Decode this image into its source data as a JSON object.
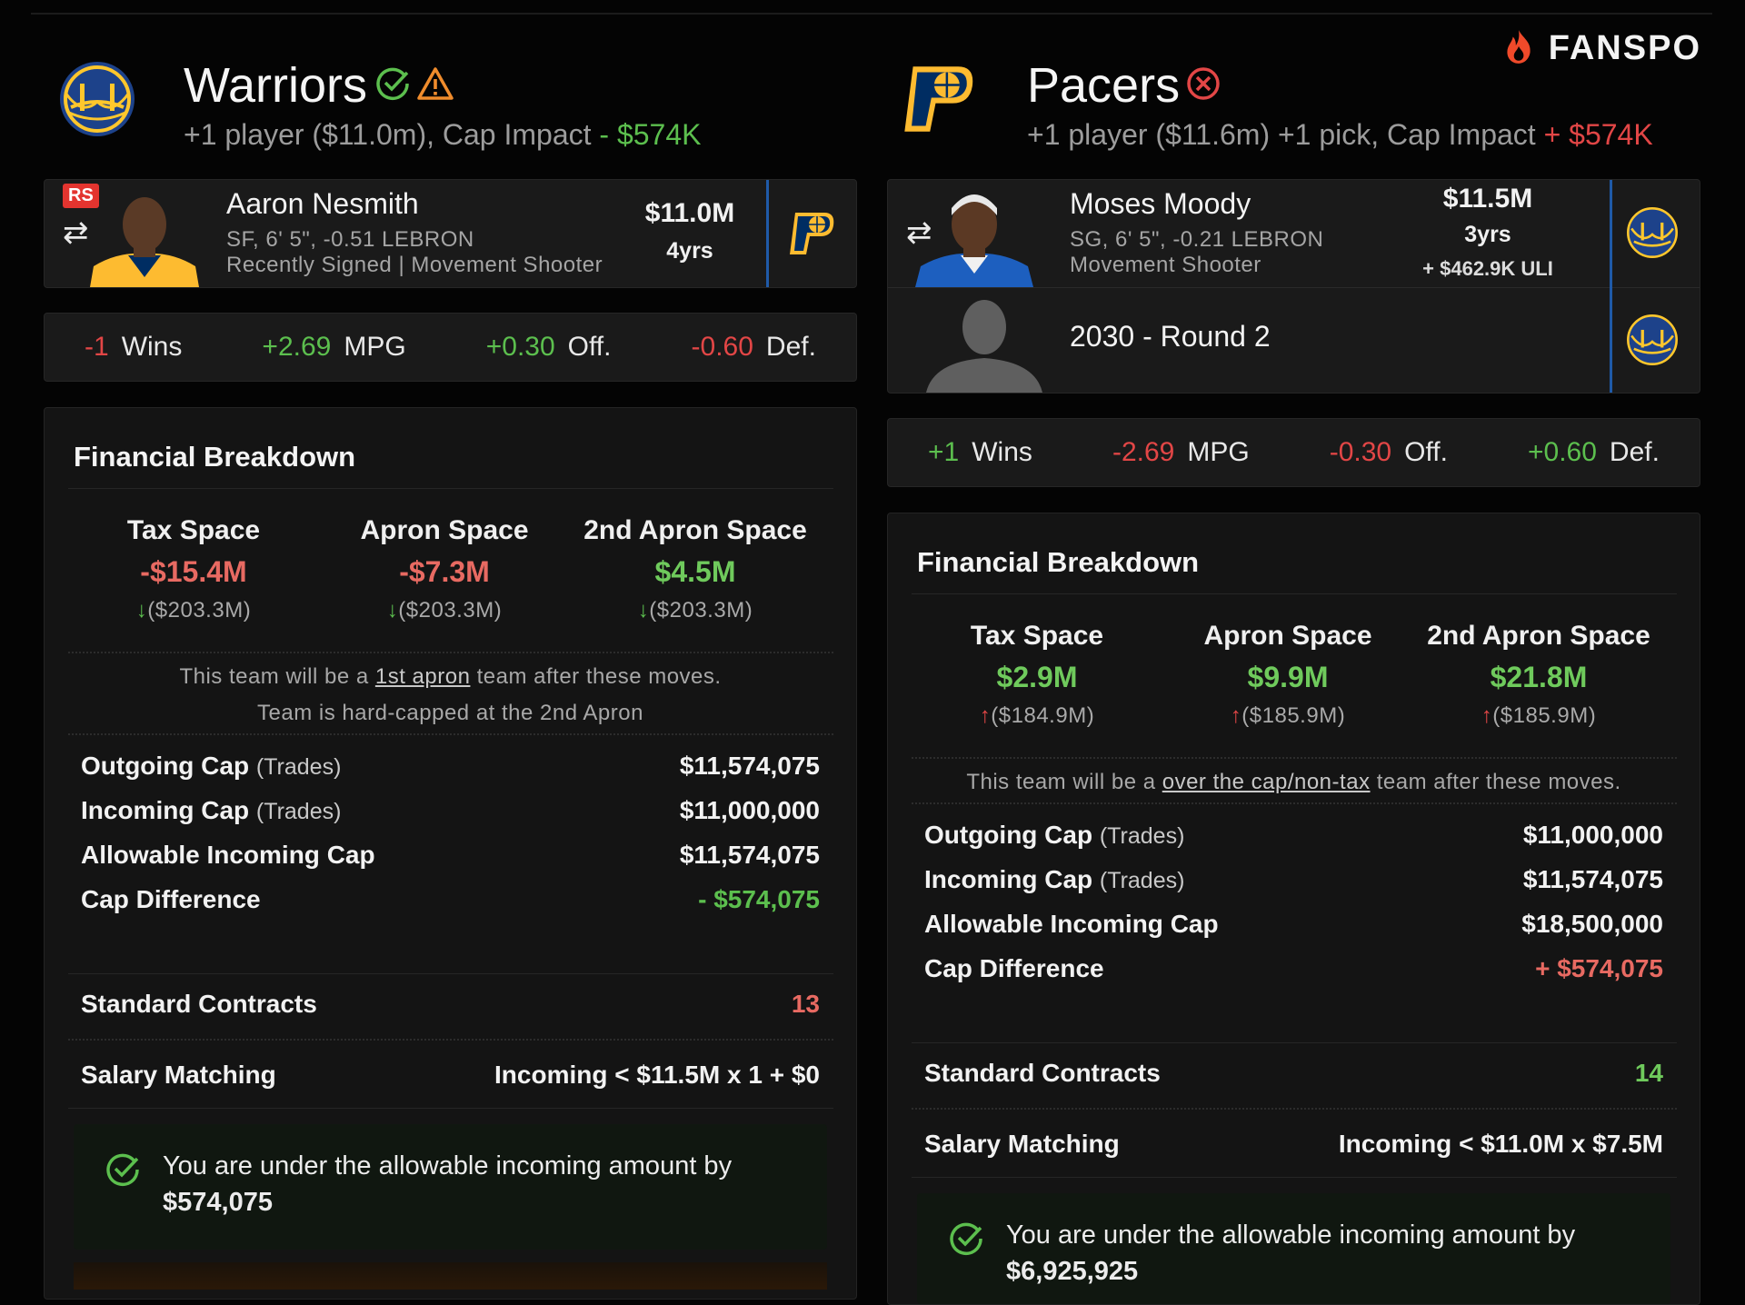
{
  "brand": {
    "name": "FANSPO",
    "icon": "flame-icon"
  },
  "left": {
    "team": {
      "name": "Warriors",
      "logo": "warriors-logo",
      "status_icons": [
        "check-circle-icon",
        "warning-triangle-icon"
      ]
    },
    "summary": {
      "text": "+1 player ($11.0m), Cap Impact",
      "sign": "-",
      "impact": "$574K",
      "impact_color": "#5cbf4e"
    },
    "player": {
      "badge": "RS",
      "name": "Aaron Nesmith",
      "meta1": "SF, 6' 5\", -0.51 LEBRON",
      "meta2": "Recently Signed | Movement Shooter",
      "salary": "$11.0M",
      "years": "4yrs",
      "from_team_logo": "pacers-logo"
    },
    "stats": [
      {
        "value": "-1",
        "label": "Wins",
        "color": "#e24646"
      },
      {
        "value": "+2.69",
        "label": "MPG",
        "color": "#5cbf4e"
      },
      {
        "value": "+0.30",
        "label": "Off.",
        "color": "#5cbf4e"
      },
      {
        "value": "-0.60",
        "label": "Def.",
        "color": "#e24646"
      }
    ],
    "financial": {
      "title": "Financial Breakdown",
      "spaces": [
        {
          "header": "Tax Space",
          "value": "-$15.4M",
          "value_color": "#e86a62",
          "delta": "($203.3M)",
          "arrow": "down",
          "arrow_color": "#5cbf4e"
        },
        {
          "header": "Apron Space",
          "value": "-$7.3M",
          "value_color": "#e86a62",
          "delta": "($203.3M)",
          "arrow": "down",
          "arrow_color": "#5cbf4e"
        },
        {
          "header": "2nd Apron Space",
          "value": "$4.5M",
          "value_color": "#6fca5c",
          "delta": "($203.3M)",
          "arrow": "down",
          "arrow_color": "#5cbf4e"
        }
      ],
      "note_pre": "This team will be a",
      "note_link": "1st apron",
      "note_post": "team after these moves.",
      "hardcap": "Team is hard-capped at the 2nd Apron",
      "rows": [
        {
          "label": "Outgoing Cap",
          "sub": "(Trades)",
          "value": "$11,574,075",
          "color": "#f2f2f2"
        },
        {
          "label": "Incoming Cap",
          "sub": "(Trades)",
          "value": "$11,000,000",
          "color": "#f2f2f2"
        },
        {
          "label": "Allowable Incoming Cap",
          "sub": "",
          "value": "$11,574,075",
          "color": "#f2f2f2"
        },
        {
          "label": "Cap Difference",
          "sub": "",
          "value": "- $574,075",
          "color": "#5cbf4e"
        }
      ],
      "contracts": {
        "label": "Standard Contracts",
        "value": "13",
        "color": "#e86a62"
      },
      "matching": {
        "label": "Salary Matching",
        "value": "Incoming < $11.5M x 1 + $0"
      },
      "callout": {
        "text": "You are under the allowable incoming amount by",
        "amount": "$574,075"
      }
    }
  },
  "right": {
    "team": {
      "name": "Pacers",
      "logo": "pacers-logo",
      "status_icons": [
        "x-circle-icon"
      ]
    },
    "summary": {
      "text": "+1 player ($11.6m) +1 pick, Cap Impact",
      "sign": "+",
      "impact": "$574K",
      "impact_color": "#e24646"
    },
    "player": {
      "name": "Moses Moody",
      "meta1": "SG, 6' 5\", -0.21 LEBRON",
      "meta2": "Movement Shooter",
      "salary": "$11.5M",
      "years": "3yrs",
      "extra": "+ $462.9K ULI",
      "from_team_logo": "warriors-logo"
    },
    "pick": {
      "label": "2030 - Round 2",
      "from_team_logo": "warriors-logo"
    },
    "stats": [
      {
        "value": "+1",
        "label": "Wins",
        "color": "#5cbf4e"
      },
      {
        "value": "-2.69",
        "label": "MPG",
        "color": "#e24646"
      },
      {
        "value": "-0.30",
        "label": "Off.",
        "color": "#e24646"
      },
      {
        "value": "+0.60",
        "label": "Def.",
        "color": "#5cbf4e"
      }
    ],
    "financial": {
      "title": "Financial Breakdown",
      "spaces": [
        {
          "header": "Tax Space",
          "value": "$2.9M",
          "value_color": "#6fca5c",
          "delta": "($184.9M)",
          "arrow": "up",
          "arrow_color": "#e24646"
        },
        {
          "header": "Apron Space",
          "value": "$9.9M",
          "value_color": "#6fca5c",
          "delta": "($185.9M)",
          "arrow": "up",
          "arrow_color": "#e24646"
        },
        {
          "header": "2nd Apron Space",
          "value": "$21.8M",
          "value_color": "#6fca5c",
          "delta": "($185.9M)",
          "arrow": "up",
          "arrow_color": "#e24646"
        }
      ],
      "note_pre": "This team will be a",
      "note_link": "over the cap/non-tax",
      "note_post": "team after these moves.",
      "rows": [
        {
          "label": "Outgoing Cap",
          "sub": "(Trades)",
          "value": "$11,000,000",
          "color": "#f2f2f2"
        },
        {
          "label": "Incoming Cap",
          "sub": "(Trades)",
          "value": "$11,574,075",
          "color": "#f2f2f2"
        },
        {
          "label": "Allowable Incoming Cap",
          "sub": "",
          "value": "$18,500,000",
          "color": "#f2f2f2"
        },
        {
          "label": "Cap Difference",
          "sub": "",
          "value": "+ $574,075",
          "color": "#e86a62"
        }
      ],
      "contracts": {
        "label": "Standard Contracts",
        "value": "14",
        "color": "#6fca5c"
      },
      "matching": {
        "label": "Salary Matching",
        "value": "Incoming < $11.0M x $7.5M"
      },
      "callout": {
        "text": "You are under the allowable incoming amount by",
        "amount": "$6,925,925"
      }
    }
  }
}
